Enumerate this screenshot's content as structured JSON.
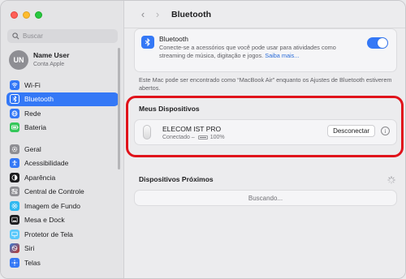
{
  "sidebar": {
    "search_placeholder": "Buscar",
    "user": {
      "initials": "UN",
      "name": "Name User",
      "subtitle": "Conta Apple"
    },
    "items": [
      {
        "label": "Wi-Fi",
        "icon": "wifi-icon",
        "color": "#3478f6"
      },
      {
        "label": "Bluetooth",
        "icon": "bluetooth-icon",
        "color": "#3478f6",
        "active": true
      },
      {
        "label": "Rede",
        "icon": "network-icon",
        "color": "#3478f6"
      },
      {
        "label": "Bateria",
        "icon": "battery-icon",
        "color": "#34c759"
      },
      {
        "label": "Geral",
        "icon": "gear-icon",
        "color": "#8e8e93"
      },
      {
        "label": "Acessibilidade",
        "icon": "accessibility-icon",
        "color": "#3478f6"
      },
      {
        "label": "Aparência",
        "icon": "appearance-icon",
        "color": "#1d1d1f"
      },
      {
        "label": "Central de Controle",
        "icon": "control-center-icon",
        "color": "#8e8e93"
      },
      {
        "label": "Imagem de Fundo",
        "icon": "wallpaper-icon",
        "color": "#2fb8f0"
      },
      {
        "label": "Mesa e Dock",
        "icon": "dock-icon",
        "color": "#1d1d1f"
      },
      {
        "label": "Protetor de Tela",
        "icon": "screensaver-icon",
        "color": "#5ac8fa"
      },
      {
        "label": "Siri",
        "icon": "siri-icon",
        "color": "#5b3cc4"
      },
      {
        "label": "Telas",
        "icon": "displays-icon",
        "color": "#3478f6"
      }
    ]
  },
  "toolbar": {
    "title": "Bluetooth",
    "back": "‹",
    "forward": "›"
  },
  "bluetooth": {
    "title": "Bluetooth",
    "description": "Conecte-se a acessórios que você pode usar para atividades como streaming de música, digitação e jogos.",
    "link": "Saiba mais...",
    "enabled": true
  },
  "note": "Este Mac pode ser encontrado como “MacBook Air” enquanto os Ajustes de Bluetooth estiverem abertos.",
  "my_devices": {
    "title": "Meus Dispositivos",
    "device": {
      "name": "ELECOM IST PRO",
      "status": "Conectado –",
      "battery": "100%",
      "button": "Desconectar"
    }
  },
  "nearby": {
    "title": "Dispositivos Próximos",
    "status": "Buscando..."
  },
  "colors": {
    "accent": "#3478f6",
    "highlight": "#e0131b"
  }
}
